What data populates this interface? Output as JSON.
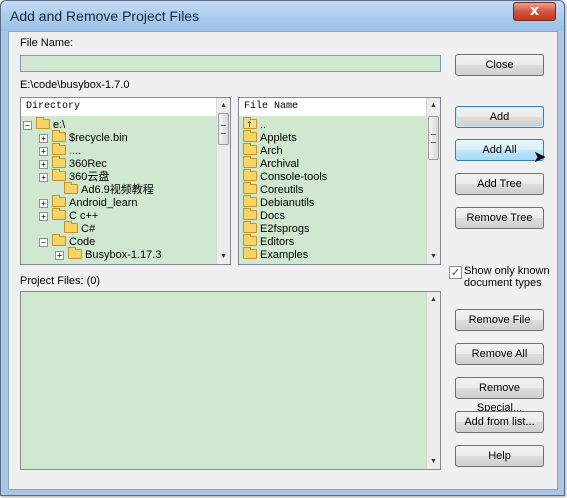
{
  "window": {
    "title": "Add and Remove Project Files",
    "close_glyph": "x"
  },
  "file_name": {
    "label": "File Name:",
    "value": ""
  },
  "current_path": "E:\\code\\busybox-1.7.0",
  "directory": {
    "header": "Directory",
    "items": [
      {
        "expander": "−",
        "label": "e:\\"
      },
      {
        "expander": "+",
        "label": "$recycle.bin"
      },
      {
        "expander": "+",
        "label": "...."
      },
      {
        "expander": "+",
        "label": "360Rec"
      },
      {
        "expander": "+",
        "label": "360云盘"
      },
      {
        "expander": "",
        "label": "Ad6.9视频教程"
      },
      {
        "expander": "+",
        "label": "Android_learn"
      },
      {
        "expander": "+",
        "label": "C c++"
      },
      {
        "expander": "",
        "label": "C#"
      },
      {
        "expander": "−",
        "label": "Code"
      },
      {
        "expander": "+",
        "label": "Busybox-1.17.3"
      }
    ]
  },
  "files": {
    "header": "File Name",
    "items": [
      "..",
      "Applets",
      "Arch",
      "Archival",
      "Console-tools",
      "Coreutils",
      "Debianutils",
      "Docs",
      "E2fsprogs",
      "Editors",
      "Examples"
    ]
  },
  "project_files": {
    "label": "Project Files: (0)"
  },
  "checkbox": {
    "label_line1": "Show only known",
    "label_line2": "document types",
    "checked": true,
    "mark": "✓"
  },
  "buttons": {
    "close": "Close",
    "add": "Add",
    "add_all": "Add All",
    "add_tree": "Add Tree",
    "remove_tree": "Remove Tree",
    "remove_file": "Remove File",
    "remove_all": "Remove All",
    "remove_special": "Remove Special...",
    "add_from_list": "Add from list...",
    "help": "Help"
  },
  "scroll_arrows": {
    "up": "▲",
    "down": "▼"
  }
}
